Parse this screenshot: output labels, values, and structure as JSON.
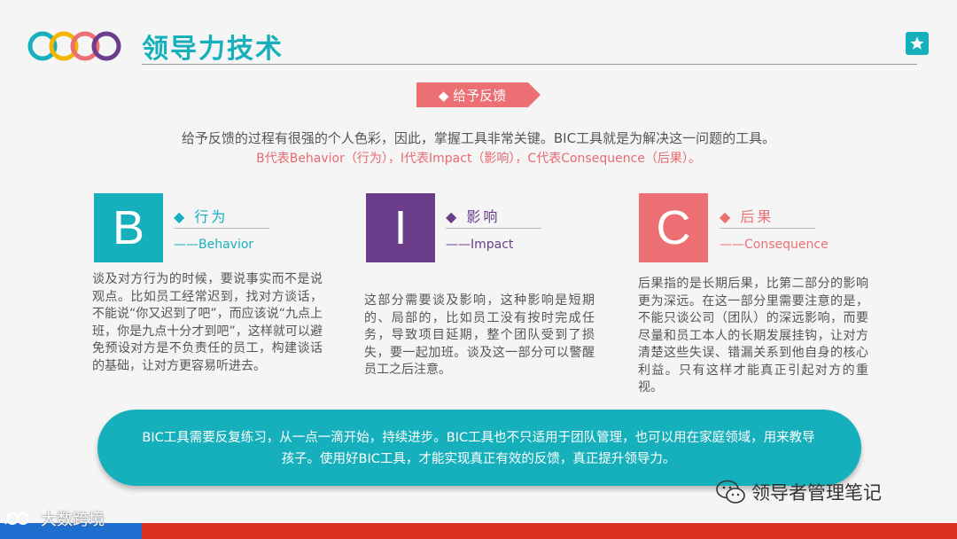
{
  "header": {
    "title": "领导力技术",
    "logo_icon": "rings-logo-icon",
    "star_icon": "star-icon"
  },
  "tag": {
    "label": "◆ 给予反馈"
  },
  "intro": {
    "line1": "给予反馈的过程有很强的个人色彩，因此，掌握工具非常关键。BIC工具就是为解决这一问题的工具。",
    "line2": "B代表Behavior（行为），I代表Impact（影响），C代表Consequence（后果）。"
  },
  "columns": [
    {
      "letter": "B",
      "title": "◆ 行为",
      "subtitle": "——Behavior",
      "color": "#16b0bd",
      "text": "谈及对方行为的时候，要说事实而不是说观点。比如员工经常迟到，找对方谈话，不能说“你又迟到了吧”，而应该说“九点上班，你是九点十分才到吧”，这样就可以避免预设对方是不负责任的员工，构建谈话的基础，让对方更容易听进去。"
    },
    {
      "letter": "I",
      "title": "◆ 影响",
      "subtitle": "——Impact",
      "color": "#6b3d8a",
      "text": "这部分需要谈及影响，这种影响是短期的、局部的，比如员工没有按时完成任务，导致项目延期，整个团队受到了损失，要一起加班。谈及这一部分可以警醒员工之后注意。"
    },
    {
      "letter": "C",
      "title": "◆ 后果",
      "subtitle": "——Consequence",
      "color": "#ec6f74",
      "text": "后果指的是长期后果，比第二部分的影响更为深远。在这一部分里需要注意的是，不能只谈公司（团队）的深远影响，而要尽量和员工本人的长期发展挂钩，让对方清楚这些失误、错漏关系到他自身的核心利益。只有这样才能真正引起对方的重视。"
    }
  ],
  "callout": {
    "text": "BIC工具需要反复练习，从一点一滴开始，持续进步。BIC工具也不只适用于团队管理，也可以用在家庭领域，用来教导孩子。使用好BIC工具，才能实现真正有效的反馈，真正提升领导力。"
  },
  "watermarks": {
    "right": "领导者管理笔记",
    "right_icon": "wechat-icon",
    "left": "大数跨境",
    "left_icon": "brand-logo-icon"
  },
  "colors": {
    "accent": "#16b0bd",
    "purple": "#6b3d8a",
    "coral": "#ec6f74",
    "bar_red": "#d9301f",
    "bar_blue": "#1f6fd1"
  }
}
